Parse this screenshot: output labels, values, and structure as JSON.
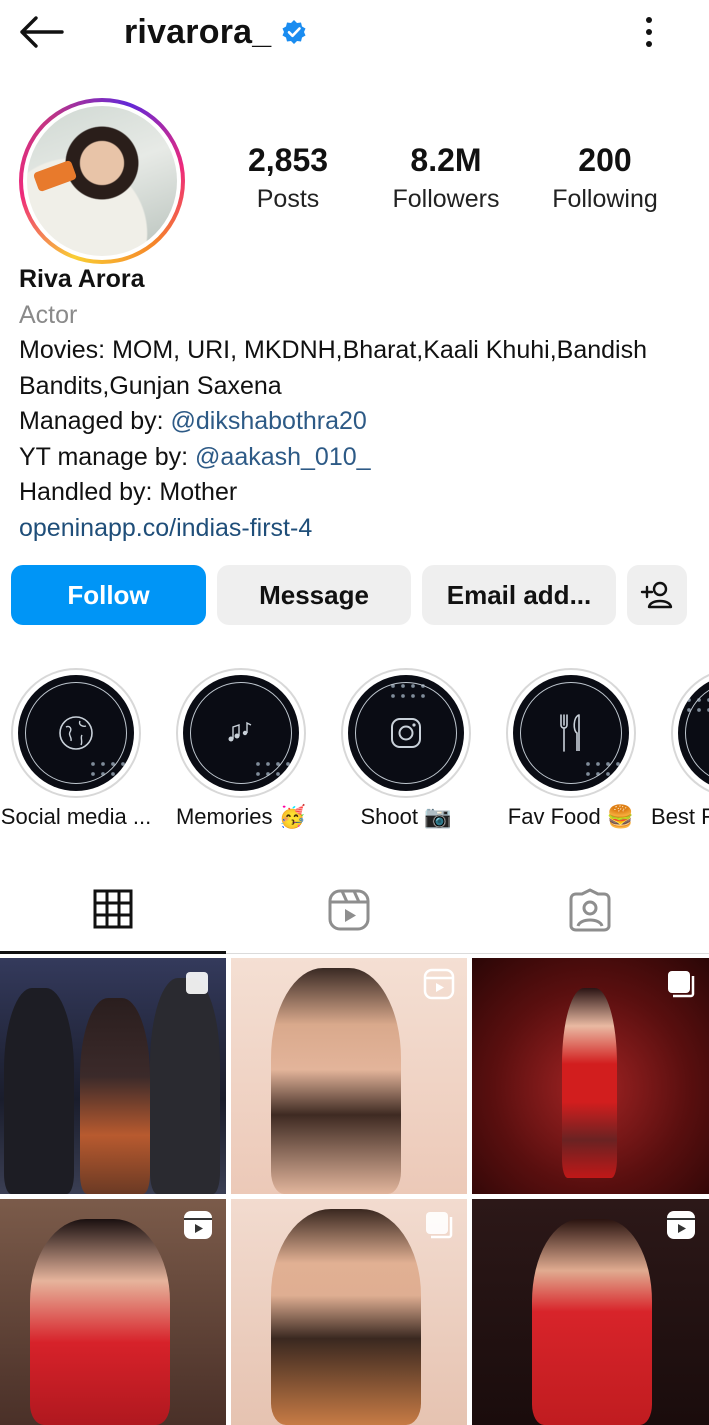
{
  "header": {
    "back_icon": "arrow-left-icon",
    "username": "rivarora_",
    "verified_icon": "verified-badge-icon",
    "more_icon": "more-vertical-icon"
  },
  "stats": [
    {
      "value": "2,853",
      "label": "Posts"
    },
    {
      "value": "8.2M",
      "label": "Followers"
    },
    {
      "value": "200",
      "label": "Following"
    }
  ],
  "bio": {
    "name": "Riva Arora",
    "category": "Actor",
    "line1": "Movies: MOM, URI, MKDNH,Bharat,Kaali Khuhi,Bandish",
    "line2": "Bandits,Gunjan Saxena",
    "managed_prefix": "Managed by: ",
    "managed_handle": "@dikshabothra20",
    "yt_prefix": "YT manage by: ",
    "yt_handle": "@aakash_010_",
    "handled": "Handled by: Mother",
    "link": "openinapp.co/indias-first-4"
  },
  "actions": {
    "follow": "Follow",
    "message": "Message",
    "email": "Email add...",
    "add_user_icon": "add-person-icon"
  },
  "highlights": [
    {
      "label": "Social media ...",
      "icon": "globe-icon"
    },
    {
      "label": "Memories 🥳",
      "icon": "music-notes-icon"
    },
    {
      "label": "Shoot 📷",
      "icon": "camera-icon"
    },
    {
      "label": "Fav Food 🍔",
      "icon": "fork-knife-icon"
    },
    {
      "label": "Best F",
      "icon": "leaf-icon"
    }
  ],
  "tabs": [
    {
      "icon": "grid-icon",
      "active": true
    },
    {
      "icon": "reels-icon",
      "active": false
    },
    {
      "icon": "tagged-icon",
      "active": false
    }
  ],
  "posts": [
    {
      "type": "carousel",
      "bg": "#2b2f45"
    },
    {
      "type": "reel",
      "bg": "#f1d9cc"
    },
    {
      "type": "carousel",
      "bg": "#7c1b1b"
    },
    {
      "type": "reel",
      "bg": "#5a3a36"
    },
    {
      "type": "carousel",
      "bg": "#f0d6c9"
    },
    {
      "type": "reel",
      "bg": "#3a2020"
    }
  ],
  "colors": {
    "accent": "#0095f6",
    "link": "#1f4e79",
    "secondary_text": "#8a8a8a"
  }
}
